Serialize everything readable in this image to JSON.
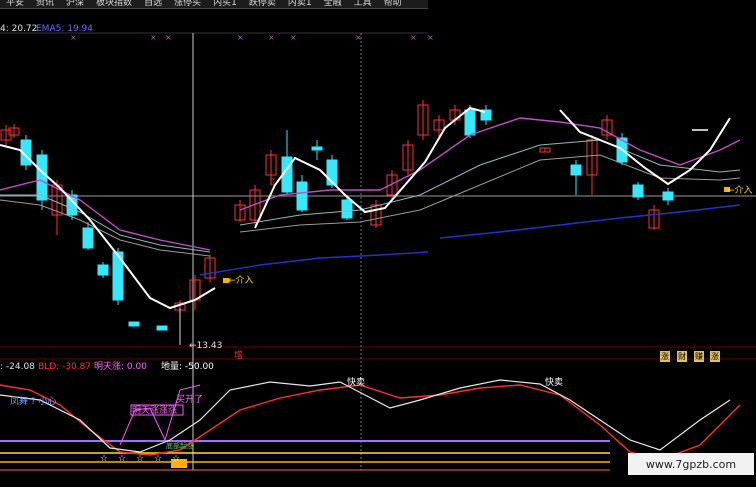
{
  "menu": [
    "平安",
    "资讯",
    "沪深",
    "板块指数",
    "自选",
    "涨停买",
    "内买1",
    "跌停卖",
    "内卖1",
    "全融",
    "工具",
    "帮助"
  ],
  "indicator_bar": {
    "value_left": "4: 20.72",
    "ma_label": "EMA5: 19.94"
  },
  "price_panel": {
    "low_label": "←13.43",
    "entry_label_left": "←介入",
    "entry_label_right": "←介入",
    "zeng_label": "增",
    "side_tags": [
      "涨",
      "财",
      "赚",
      "涨"
    ]
  },
  "lower_panel": {
    "header": {
      "v1": ": -24.08",
      "bld_label": "BLD: -30.87",
      "mingtian": "明天涨: 0.00",
      "diliang": "地量: -50.00"
    },
    "kuaimai_1": "快卖",
    "kuaimai_2": "快卖",
    "fengwu": "凤舞 ? 小心",
    "mingtian_zhang": "明天涨涨涨",
    "kaimai": "买开了",
    "small_text": "底部起涨"
  },
  "watermark": "www.7gpzb.com",
  "colors": {
    "up": "#ff3333",
    "down": "#33e8ff",
    "white_line": "#ffffff",
    "magenta": "#c050c0",
    "gray_ma": "#9a9a9a",
    "teal_ma": "#88bbbb",
    "blue_ma": "#2233cc",
    "grid_red": "#6a0000",
    "yellow": "#ffe020",
    "orange": "#ffb000",
    "purple_line": "#a070ff"
  }
}
